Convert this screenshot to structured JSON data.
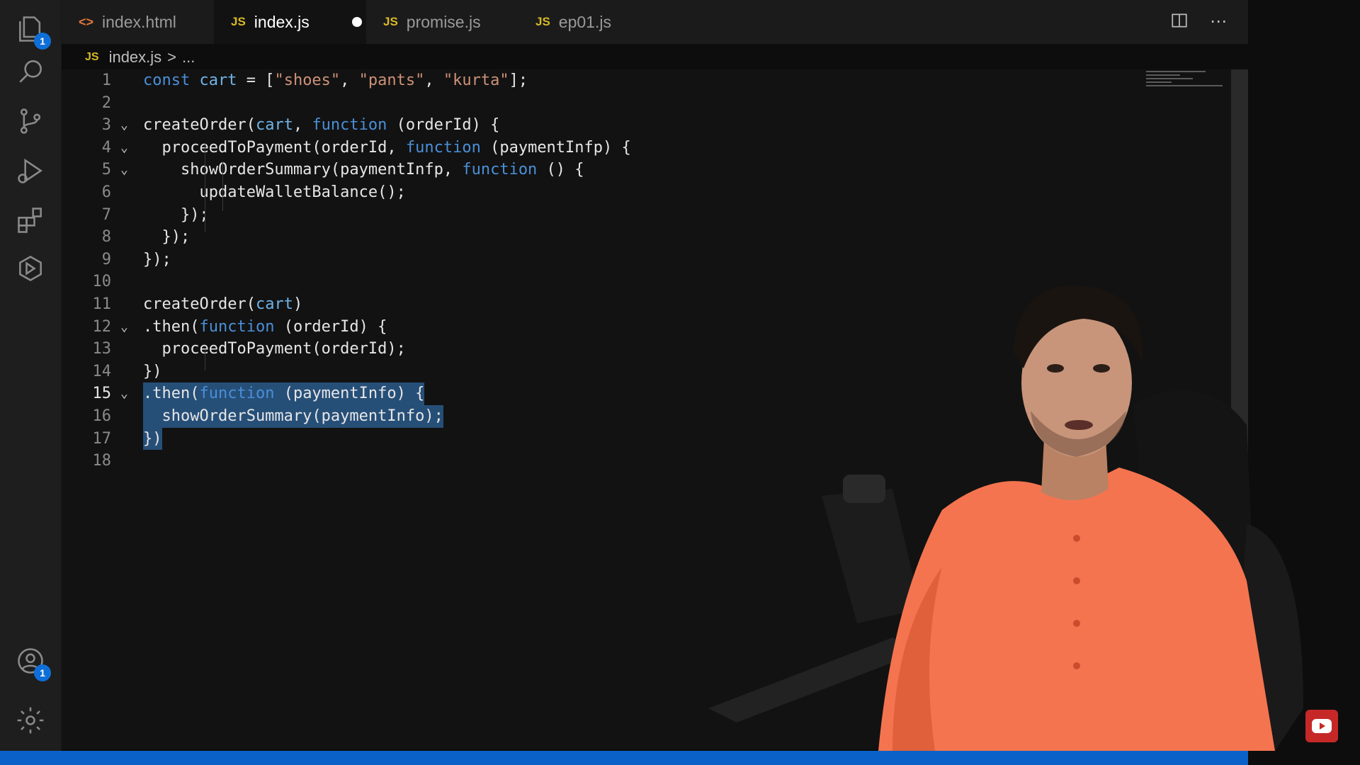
{
  "tabs": [
    {
      "label": "index.html",
      "icon": "html-file-icon",
      "active": false
    },
    {
      "label": "index.js",
      "icon": "js-file-icon",
      "active": true,
      "unsaved": true
    },
    {
      "label": "promise.js",
      "icon": "js-file-icon",
      "active": false
    },
    {
      "label": "ep01.js",
      "icon": "js-file-icon",
      "active": false
    }
  ],
  "tab_icon_text": {
    "js": "JS",
    "html": "<>"
  },
  "breadcrumb": {
    "file": "index.js",
    "separator": ">",
    "rest": "..."
  },
  "activity_bar": {
    "explorer_badge": "1",
    "accounts_badge": "1"
  },
  "editor": {
    "current_line": 15,
    "lines": [
      {
        "n": "1",
        "code": "const cart = [\"shoes\", \"pants\", \"kurta\"];"
      },
      {
        "n": "2",
        "code": ""
      },
      {
        "n": "3",
        "code": "createOrder(cart, function (orderId) {"
      },
      {
        "n": "4",
        "code": "  proceedToPayment(orderId, function (paymentInfp) {"
      },
      {
        "n": "5",
        "code": "    showOrderSummary(paymentInfp, function () {"
      },
      {
        "n": "6",
        "code": "      updateWalletBalance();"
      },
      {
        "n": "7",
        "code": "    });"
      },
      {
        "n": "8",
        "code": "  });"
      },
      {
        "n": "9",
        "code": "});"
      },
      {
        "n": "10",
        "code": ""
      },
      {
        "n": "11",
        "code": "createOrder(cart)"
      },
      {
        "n": "12",
        "code": ".then(function (orderId) {"
      },
      {
        "n": "13",
        "code": "  proceedToPayment(orderId);"
      },
      {
        "n": "14",
        "code": "})"
      },
      {
        "n": "15",
        "code": ".then(function (paymentInfo) {"
      },
      {
        "n": "16",
        "code": "  showOrderSummary(paymentInfo);"
      },
      {
        "n": "17",
        "code": "})"
      },
      {
        "n": "18",
        "code": ""
      }
    ]
  },
  "colors": {
    "accent": "#0a62c9",
    "keyword": "#4a8fd8",
    "string": "#ce9178",
    "selection": "#264f78",
    "shirt": "#f4744f"
  }
}
